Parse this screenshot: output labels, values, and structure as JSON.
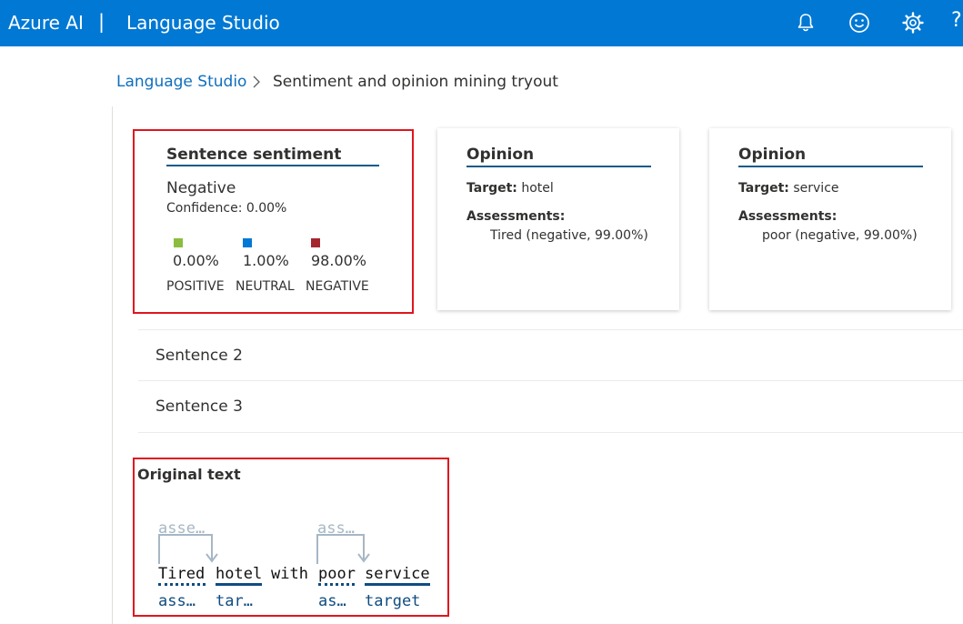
{
  "header": {
    "brand": "Azure AI",
    "separator": "|",
    "product": "Language Studio",
    "icons": [
      "bell-icon",
      "feedback-smiley-icon",
      "settings-gear-icon",
      "help-icon"
    ],
    "help_glyph": "?"
  },
  "breadcrumb": {
    "root": "Language Studio",
    "chevron": ">",
    "current": "Sentiment and opinion mining tryout"
  },
  "sentence_sentiment": {
    "title": "Sentence sentiment",
    "label": "Negative",
    "confidence": "Confidence: 0.00%",
    "scores": [
      {
        "pct": "0.00%",
        "category": "POSITIVE",
        "color": "#8cbd3f"
      },
      {
        "pct": "1.00%",
        "category": "NEUTRAL",
        "color": "#0078d4"
      },
      {
        "pct": "98.00%",
        "category": "NEGATIVE",
        "color": "#a4262c"
      }
    ]
  },
  "opinions": [
    {
      "title": "Opinion",
      "target_label": "Target:",
      "target_value": "hotel",
      "assessments_label": "Assessments:",
      "assessment": "Tired (negative, 99.00%)"
    },
    {
      "title": "Opinion",
      "target_label": "Target:",
      "target_value": "service",
      "assessments_label": "Assessments:",
      "assessment": "poor (negative, 99.00%)"
    }
  ],
  "sentences": [
    {
      "label": "Sentence 2"
    },
    {
      "label": "Sentence 3"
    }
  ],
  "original_text": {
    "title": "Original text",
    "arc_labels": [
      "asse…",
      "ass…"
    ],
    "words": [
      "Tired",
      "hotel",
      "with",
      "poor",
      "service"
    ],
    "tags": [
      "ass…",
      "tar…",
      "as…",
      "target"
    ]
  }
}
